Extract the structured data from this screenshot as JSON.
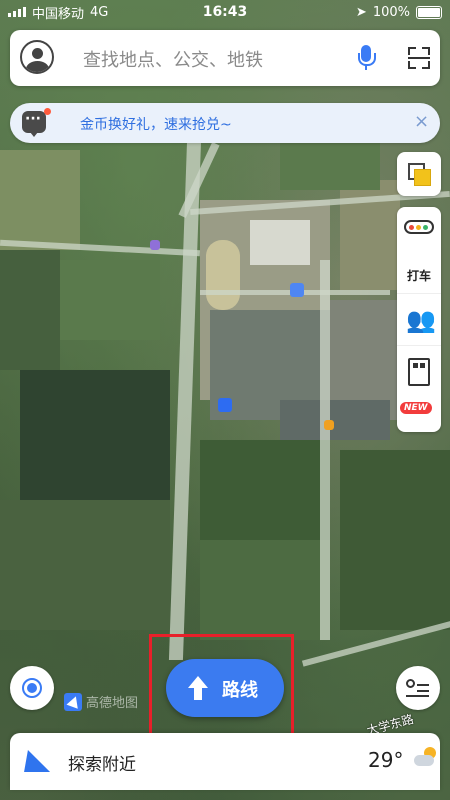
{
  "status_bar": {
    "carrier": "中国移动",
    "network": "4G",
    "time": "16:43",
    "battery": "100%"
  },
  "search": {
    "placeholder": "查找地点、公交、地铁"
  },
  "promo": {
    "text": "金币换好礼，速来抢兑~",
    "close": "×"
  },
  "right_tools": {
    "taxi_label": "打车",
    "new_badge": "NEW"
  },
  "map": {
    "logo_text": "高德地图",
    "road_label": "大学东路"
  },
  "route_button": {
    "label": "路线"
  },
  "bottom_bar": {
    "nearby_label": "探索附近",
    "temperature": "29°"
  },
  "colors": {
    "accent": "#3b7bf0",
    "highlight": "#e8202a",
    "promo_text": "#2f6fe0"
  },
  "icons": {
    "avatar": "avatar-icon",
    "mic": "mic-icon",
    "scan": "scan-icon",
    "message": "message-icon",
    "layers": "layers-icon",
    "taxi": "taxi-icon",
    "walk": "walk-icon",
    "bus_new": "bus-icon",
    "locate": "locate-icon",
    "route": "route-arrow-icon",
    "list": "list-icon",
    "nearby": "send-icon",
    "weather": "partly-sunny-icon"
  }
}
